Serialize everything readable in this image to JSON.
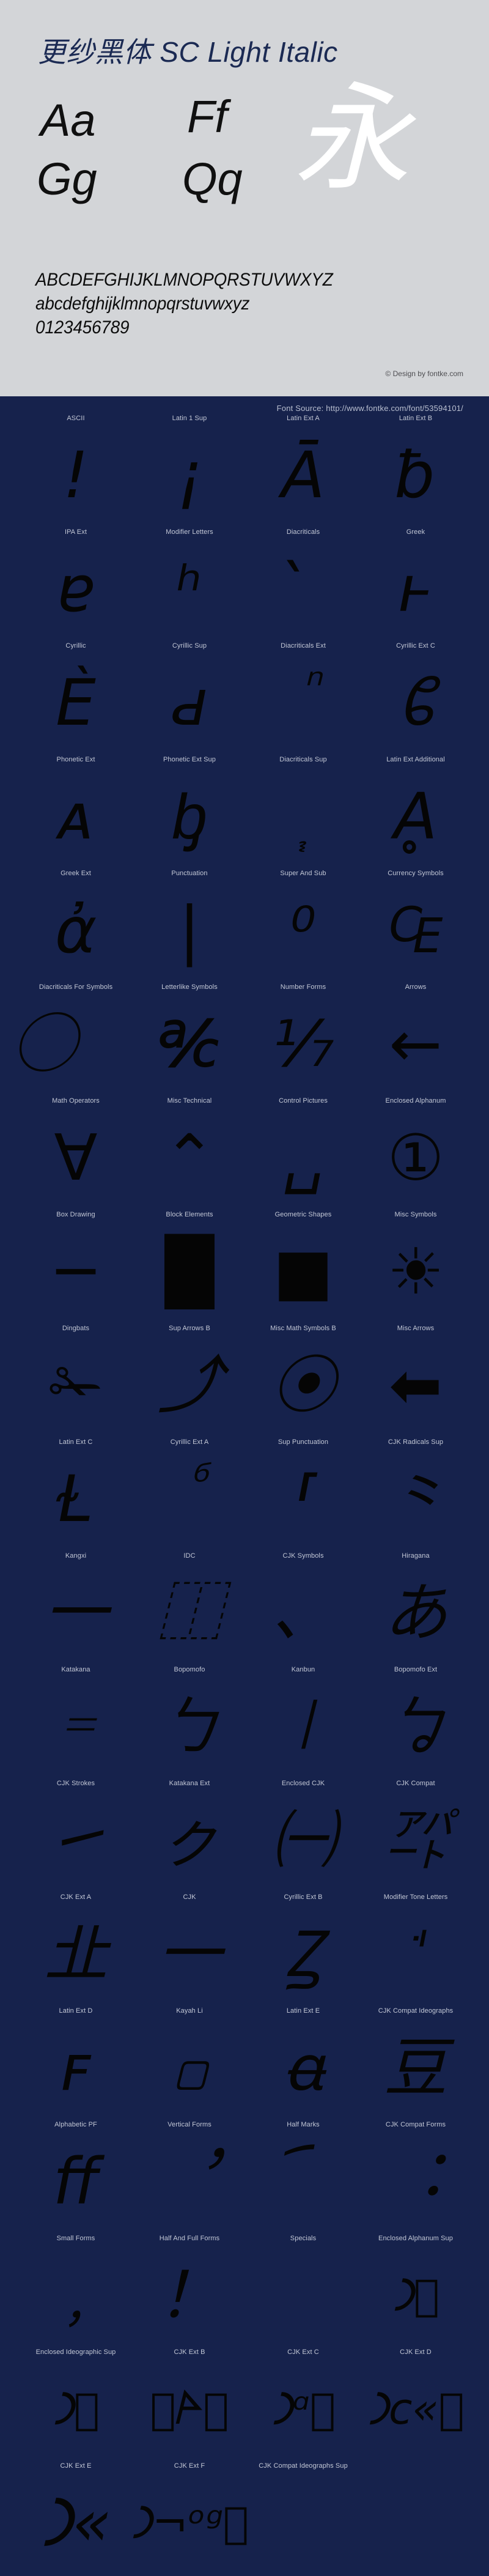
{
  "header": {
    "font_title_cjk": "更纱黑体",
    "font_title_latin": " SC Light Italic",
    "font_title_full": "更纱黑体 SC Light Italic",
    "samples": [
      {
        "id": "aa",
        "text": "Aa"
      },
      {
        "id": "ff",
        "text": "Ff"
      },
      {
        "id": "gg",
        "text": "Gg"
      },
      {
        "id": "qq",
        "text": "Qq"
      }
    ],
    "cjk_sample": "永",
    "alphabet_uppercase": "ABCDEFGHIJKLMNOPQRSTUVWXYZ",
    "alphabet_lowercase": "abcdefghijklmnopqrstuvwxyz",
    "digits": "0123456789",
    "design_credit": "© Design by fontke.com",
    "colors": {
      "panel_background": "#d3d5d8",
      "title_color": "#1b2a53",
      "glyph_color": "#101010",
      "cjk_color": "#ffffff",
      "credit_color": "#4e4e52"
    }
  },
  "dark_section": {
    "font_source_label": "Font Source: http://www.fontke.com/font/53594101/",
    "colors": {
      "background": "#16224c",
      "label_color": "#c3c8d6",
      "glyph_color": "#050505",
      "source_color": "#b9bfd0"
    },
    "unicode_blocks": [
      {
        "label": "ASCII",
        "glyph": "!",
        "size": "normal"
      },
      {
        "label": "Latin 1 Sup",
        "glyph": "¡",
        "size": "normal"
      },
      {
        "label": "Latin Ext A",
        "glyph": "Ā",
        "size": "normal"
      },
      {
        "label": "Latin Ext B",
        "glyph": "ƀ",
        "size": "normal"
      },
      {
        "label": "IPA Ext",
        "glyph": "ɐ",
        "size": "normal"
      },
      {
        "label": "Modifier Letters",
        "glyph": "ʰ",
        "size": "normal"
      },
      {
        "label": "Diacriticals",
        "glyph": "̀",
        "size": "normal"
      },
      {
        "label": "Greek",
        "glyph": "ͱ",
        "size": "normal"
      },
      {
        "label": "Cyrillic",
        "glyph": "Ѐ",
        "size": "normal"
      },
      {
        "label": "Cyrillic Sup",
        "glyph": "ԁ",
        "size": "normal"
      },
      {
        "label": "Diacriticals Ext",
        "glyph": "ᷠ",
        "size": "normal"
      },
      {
        "label": "Cyrillic Ext C",
        "glyph": "ᲀ",
        "size": "normal"
      },
      {
        "label": "Phonetic Ext",
        "glyph": "ᴀ",
        "size": "normal"
      },
      {
        "label": "Phonetic Ext Sup",
        "glyph": "ᶀ",
        "size": "normal"
      },
      {
        "label": "Diacriticals Sup",
        "glyph": "᷂",
        "size": "normal"
      },
      {
        "label": "Latin Ext Additional",
        "glyph": "Ḁ",
        "size": "normal"
      },
      {
        "label": "Greek Ext",
        "glyph": "ἀ",
        "size": "normal"
      },
      {
        "label": "Punctuation",
        "glyph": "|",
        "size": "normal"
      },
      {
        "label": "Super And Sub",
        "glyph": "⁰",
        "size": "normal"
      },
      {
        "label": "Currency Symbols",
        "glyph": "₠",
        "size": "normal"
      },
      {
        "label": "Diacriticals For Symbols",
        "glyph": "⃝",
        "size": "normal"
      },
      {
        "label": "Letterlike Symbols",
        "glyph": "℀",
        "size": "normal"
      },
      {
        "label": "Number Forms",
        "glyph": "⅐",
        "size": "normal"
      },
      {
        "label": "Arrows",
        "glyph": "←",
        "size": "normal"
      },
      {
        "label": "Math Operators",
        "glyph": "∀",
        "size": "normal"
      },
      {
        "label": "Misc Technical",
        "glyph": "⌃",
        "size": "normal"
      },
      {
        "label": "Control Pictures",
        "glyph": "␣",
        "size": "normal"
      },
      {
        "label": "Enclosed Alphanum",
        "glyph": "①",
        "size": "normal"
      },
      {
        "label": "Box Drawing",
        "glyph": "─",
        "size": "normal"
      },
      {
        "label": "Block Elements",
        "glyph": "█",
        "size": "normal"
      },
      {
        "label": "Geometric Shapes",
        "glyph": "■",
        "size": "normal"
      },
      {
        "label": "Misc Symbols",
        "glyph": "☀",
        "size": "normal"
      },
      {
        "label": "Dingbats",
        "glyph": "✁",
        "size": "normal"
      },
      {
        "label": "Sup Arrows B",
        "glyph": "⤴",
        "size": "normal"
      },
      {
        "label": "Misc Math Symbols B",
        "glyph": "⦿",
        "size": "normal"
      },
      {
        "label": "Misc Arrows",
        "glyph": "⬅",
        "size": "normal"
      },
      {
        "label": "Latin Ext C",
        "glyph": "Ɫ",
        "size": "normal"
      },
      {
        "label": "Cyrillic Ext A",
        "glyph": "ⷠ",
        "size": "normal"
      },
      {
        "label": "Sup Punctuation",
        "glyph": "⸢",
        "size": "normal"
      },
      {
        "label": "CJK Radicals Sup",
        "glyph": "⺀",
        "size": "normal"
      },
      {
        "label": "Kangxi",
        "glyph": "⼀",
        "size": "normal"
      },
      {
        "label": "IDC",
        "glyph": "⿰",
        "size": "normal"
      },
      {
        "label": "CJK Symbols",
        "glyph": "、",
        "size": "normal"
      },
      {
        "label": "Hiragana",
        "glyph": "あ",
        "size": "normal"
      },
      {
        "label": "Katakana",
        "glyph": "゠",
        "size": "normal"
      },
      {
        "label": "Bopomofo",
        "glyph": "ㄅ",
        "size": "normal"
      },
      {
        "label": "Kanbun",
        "glyph": "㆐",
        "size": "normal"
      },
      {
        "label": "Bopomofo Ext",
        "glyph": "ㆠ",
        "size": "normal"
      },
      {
        "label": "CJK Strokes",
        "glyph": "㇀",
        "size": "normal"
      },
      {
        "label": "Katakana Ext",
        "glyph": "ㇰ",
        "size": "normal"
      },
      {
        "label": "Enclosed CJK",
        "glyph": "㈠",
        "size": "normal"
      },
      {
        "label": "CJK Compat",
        "glyph": "㌀",
        "size": "normal"
      },
      {
        "label": "CJK Ext A",
        "glyph": "㐀",
        "size": "normal"
      },
      {
        "label": "CJK",
        "glyph": "一",
        "size": "normal"
      },
      {
        "label": "Cyrillic Ext B",
        "glyph": "Ꙁ",
        "size": "normal"
      },
      {
        "label": "Modifier Tone Letters",
        "glyph": "ꜗ",
        "size": "normal"
      },
      {
        "label": "Latin Ext D",
        "glyph": "ꜰ",
        "size": "normal"
      },
      {
        "label": "Kayah Li",
        "glyph": "꤀",
        "size": "normal"
      },
      {
        "label": "Latin Ext E",
        "glyph": "ꬰ",
        "size": "normal"
      },
      {
        "label": "CJK Compat Ideographs",
        "glyph": "豆",
        "size": "normal"
      },
      {
        "label": "Alphabetic PF",
        "glyph": "ﬀ",
        "size": "normal"
      },
      {
        "label": "Vertical Forms",
        "glyph": "︐",
        "size": "normal"
      },
      {
        "label": "Half Marks",
        "glyph": "︠",
        "size": "normal"
      },
      {
        "label": "CJK Compat Forms",
        "glyph": "︓",
        "size": "normal"
      },
      {
        "label": "Small Forms",
        "glyph": "﹐",
        "size": "normal"
      },
      {
        "label": "Half And Full Forms",
        "glyph": "！",
        "size": "normal"
      },
      {
        "label": "Specials",
        "glyph": "￼",
        "size": "normal"
      },
      {
        "label": "Enclosed Alphanum Sup",
        "glyph": "𐅀􀀀",
        "size": "small"
      },
      {
        "label": "Enclosed Ideographic Sup",
        "glyph": "𐅀􀀀",
        "size": "small"
      },
      {
        "label": "CJK Ext B",
        "glyph": "􀀀𐊀􀀀",
        "size": "small"
      },
      {
        "label": "CJK Ext C",
        "glyph": "𐅀ᵅ􀀀",
        "size": "small"
      },
      {
        "label": "CJK Ext D",
        "glyph": "𐅀ᴄ«􀀀",
        "size": "small"
      },
      {
        "label": "CJK Ext E",
        "glyph": "𐅀«",
        "size": "normal"
      },
      {
        "label": "CJK Ext F",
        "glyph": "𐅀¬ᵒᵍ􀀀",
        "size": "small"
      },
      {
        "label": "CJK Compat Ideographs Sup",
        "glyph": "",
        "size": "normal"
      }
    ]
  }
}
